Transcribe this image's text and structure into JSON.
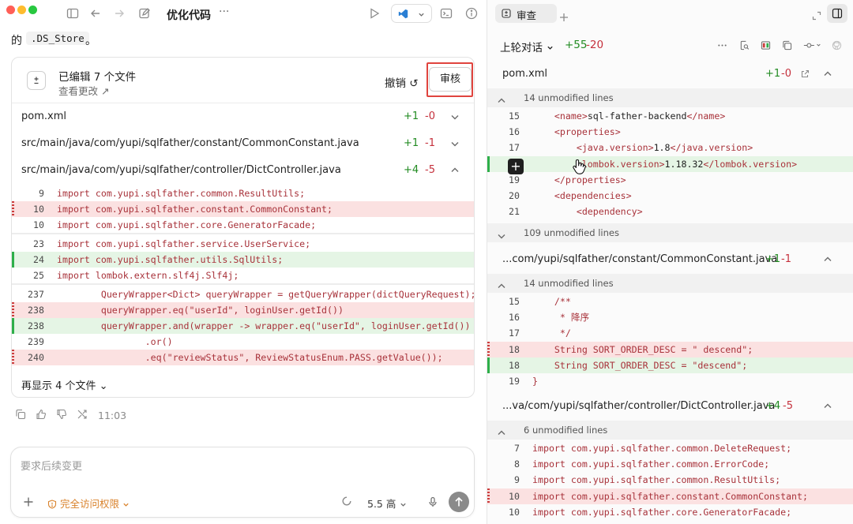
{
  "window": {
    "title": "优化代码",
    "more": "···"
  },
  "left": {
    "prev_message": {
      "prefix": "的",
      "code": ".DS_Store",
      "suffix": "。"
    },
    "changes_card": {
      "title": "已编辑 7 个文件",
      "subtitle": "查看更改 ↗",
      "undo_label": "撤销 ↺",
      "review_label": "审核",
      "files": [
        {
          "name": "pom.xml",
          "added": "+1",
          "removed": "-0",
          "expanded": false
        },
        {
          "name": "src/main/java/com/yupi/sqlfather/constant/CommonConstant.java",
          "added": "+1",
          "removed": "-1",
          "expanded": false
        },
        {
          "name": "src/main/java/com/yupi/sqlfather/controller/DictController.java",
          "added": "+4",
          "removed": "-5",
          "expanded": true
        }
      ],
      "hunks": [
        {
          "lines": [
            {
              "num": "9",
              "type": "ctx",
              "code": "import com.yupi.sqlfather.common.ResultUtils;"
            },
            {
              "num": "10",
              "type": "del",
              "code": "import com.yupi.sqlfather.constant.CommonConstant;"
            },
            {
              "num": "10",
              "type": "ctx",
              "code": "import com.yupi.sqlfather.core.GeneratorFacade;"
            }
          ]
        },
        {
          "lines": [
            {
              "num": "23",
              "type": "ctx",
              "code": "import com.yupi.sqlfather.service.UserService;"
            },
            {
              "num": "24",
              "type": "add",
              "code": "import com.yupi.sqlfather.utils.SqlUtils;"
            },
            {
              "num": "25",
              "type": "ctx",
              "code": "import lombok.extern.slf4j.Slf4j;"
            }
          ]
        },
        {
          "lines": [
            {
              "num": "237",
              "type": "ctx",
              "code": "        QueryWrapper<Dict> queryWrapper = getQueryWrapper(dictQueryRequest);"
            },
            {
              "num": "238",
              "type": "del",
              "code": "        queryWrapper.eq(\"userId\", loginUser.getId())"
            },
            {
              "num": "238",
              "type": "add",
              "code": "        queryWrapper.and(wrapper -> wrapper.eq(\"userId\", loginUser.getId())"
            },
            {
              "num": "239",
              "type": "ctx",
              "code": "                .or()"
            },
            {
              "num": "240",
              "type": "del",
              "code": "                .eq(\"reviewStatus\", ReviewStatusEnum.PASS.getValue());"
            }
          ]
        }
      ],
      "show_more": "再显示 4 个文件 ⌄"
    },
    "message_time": "11:03",
    "composer": {
      "placeholder": "要求后续变更",
      "permission": "完全访问权限",
      "model": "5.5 高"
    }
  },
  "right": {
    "tab_label": "审查",
    "round_label": "上轮对话",
    "round_added": "+55",
    "round_removed": "-20",
    "files": [
      {
        "name": "pom.xml",
        "added": "+1",
        "removed": "-0",
        "sections": [
          {
            "kind": "unmod",
            "text": "14 unmodified lines",
            "chev": "up"
          },
          {
            "kind": "lines",
            "lines": [
              {
                "num": "15",
                "type": "ctx",
                "code": "    <name>sql-father-backend</name>"
              },
              {
                "num": "16",
                "type": "ctx",
                "code": "    <properties>"
              },
              {
                "num": "17",
                "type": "ctx",
                "code": "        <java.version>1.8</java.version>"
              },
              {
                "num": "18",
                "type": "add",
                "code": "        <lombok.version>1.18.32</lombok.version>"
              },
              {
                "num": "19",
                "type": "ctx",
                "code": "    </properties>"
              },
              {
                "num": "20",
                "type": "ctx",
                "code": "    <dependencies>"
              },
              {
                "num": "21",
                "type": "ctx",
                "code": "        <dependency>"
              }
            ]
          },
          {
            "kind": "unmod",
            "text": "109 unmodified lines",
            "chev": "down"
          }
        ]
      },
      {
        "name": "...com/yupi/sqlfather/constant/CommonConstant.java",
        "added": "+1",
        "removed": "-1",
        "sections": [
          {
            "kind": "unmod",
            "text": "14 unmodified lines",
            "chev": "up"
          },
          {
            "kind": "lines",
            "lines": [
              {
                "num": "15",
                "type": "ctx",
                "code": "    /**"
              },
              {
                "num": "16",
                "type": "ctx",
                "code": "     * 降序"
              },
              {
                "num": "17",
                "type": "ctx",
                "code": "     */"
              },
              {
                "num": "18",
                "type": "del",
                "code": "    String SORT_ORDER_DESC = \" descend\";"
              },
              {
                "num": "18",
                "type": "add",
                "code": "    String SORT_ORDER_DESC = \"descend\";"
              },
              {
                "num": "19",
                "type": "ctx",
                "code": "}"
              }
            ]
          }
        ]
      },
      {
        "name": "...va/com/yupi/sqlfather/controller/DictController.java",
        "added": "+4",
        "removed": "-5",
        "sections": [
          {
            "kind": "unmod",
            "text": "6 unmodified lines",
            "chev": "up"
          },
          {
            "kind": "lines",
            "lines": [
              {
                "num": "7",
                "type": "ctx",
                "code": "import com.yupi.sqlfather.common.DeleteRequest;"
              },
              {
                "num": "8",
                "type": "ctx",
                "code": "import com.yupi.sqlfather.common.ErrorCode;"
              },
              {
                "num": "9",
                "type": "ctx",
                "code": "import com.yupi.sqlfather.common.ResultUtils;"
              },
              {
                "num": "10",
                "type": "del",
                "code": "import com.yupi.sqlfather.constant.CommonConstant;"
              },
              {
                "num": "10",
                "type": "ctx",
                "code": "import com.yupi.sqlfather.core.GeneratorFacade;"
              }
            ]
          }
        ]
      }
    ]
  },
  "colors": {
    "added": "#228b22",
    "removed": "#c5303c",
    "code": "#a8323a",
    "warning": "#d9822b",
    "highlight_box": "#e0443e"
  }
}
